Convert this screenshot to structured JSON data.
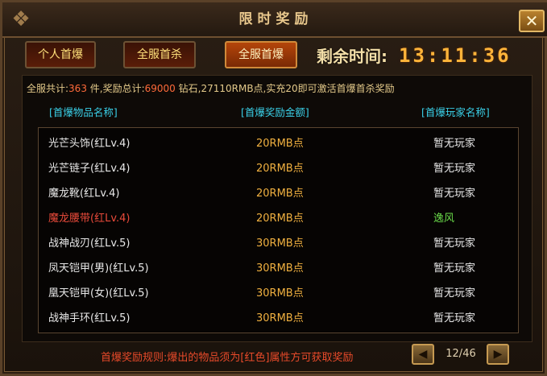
{
  "header": {
    "title": "限时奖励",
    "corner_glyph": "❖",
    "close_label": "✕"
  },
  "tabs": [
    {
      "label": "个人首爆",
      "active": false
    },
    {
      "label": "全服首杀",
      "active": false
    },
    {
      "label": "全服首爆",
      "active": true
    }
  ],
  "timer": {
    "label": "剩余时间:",
    "value": "13:11:36"
  },
  "summary": {
    "prefix": "全服共计:",
    "count": "363",
    "middle": " 件,奖励总计:",
    "total": "69000",
    "suffix": " 钻石,27110RMB点,实充20即可激活首爆首杀奖励"
  },
  "columns": {
    "item": "[首爆物品名称]",
    "reward": "[首爆奖励金额]",
    "player": "[首爆玩家名称]"
  },
  "rows": [
    {
      "item": "光芒头饰(红Lv.4)",
      "reward": "20RMB点",
      "player": "暂无玩家",
      "highlight": false
    },
    {
      "item": "光芒链子(红Lv.4)",
      "reward": "20RMB点",
      "player": "暂无玩家",
      "highlight": false
    },
    {
      "item": "魔龙靴(红Lv.4)",
      "reward": "20RMB点",
      "player": "暂无玩家",
      "highlight": false
    },
    {
      "item": "魔龙腰带(红Lv.4)",
      "reward": "20RMB点",
      "player": "逸风",
      "highlight": true
    },
    {
      "item": "战神战刃(红Lv.5)",
      "reward": "30RMB点",
      "player": "暂无玩家",
      "highlight": false
    },
    {
      "item": "凤天铠甲(男)(红Lv.5)",
      "reward": "30RMB点",
      "player": "暂无玩家",
      "highlight": false
    },
    {
      "item": "凰天铠甲(女)(红Lv.5)",
      "reward": "30RMB点",
      "player": "暂无玩家",
      "highlight": false
    },
    {
      "item": "战神手环(红Lv.5)",
      "reward": "30RMB点",
      "player": "暂无玩家",
      "highlight": false
    }
  ],
  "footer": {
    "rule": "首爆奖励规则:爆出的物品须为[红色]属性方可获取奖励",
    "page": "12/46",
    "prev_glyph": "◀",
    "next_glyph": "▶"
  },
  "colors": {
    "accent": "#ffb43a",
    "highlight_item": "#e84a3a",
    "highlight_player": "#6adc4a",
    "column_header": "#3ad0e8"
  }
}
